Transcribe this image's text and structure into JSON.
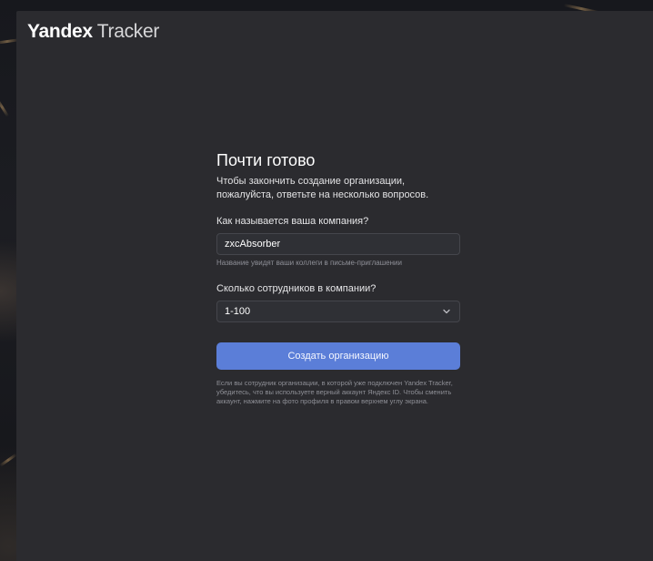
{
  "brand": {
    "yandex": "Yandex",
    "product": "Tracker"
  },
  "form": {
    "title": "Почти готово",
    "subtitle": "Чтобы закончить создание организации, пожалуйста, ответьте на несколько вопросов.",
    "company": {
      "label": "Как называется ваша компания?",
      "value": "zxcAbsorber",
      "hint": "Название увидят ваши коллеги в письме-приглашении"
    },
    "employees": {
      "label": "Сколько сотрудников в компании?",
      "selected": "1-100",
      "icon": "chevron-down-icon"
    },
    "submit_label": "Создать организацию",
    "note": "Если вы сотрудник организации, в которой уже подключен Yandex Tracker, убедитесь, что вы используете верный аккаунт Яндекс ID. Чтобы сменить аккаунт, нажмите на фото профиля в правом верхнем углу экрана."
  },
  "colors": {
    "panel": "#2b2b2f",
    "primary": "#5b7ed8",
    "text": "#ffffff",
    "muted": "#8e8f96"
  }
}
